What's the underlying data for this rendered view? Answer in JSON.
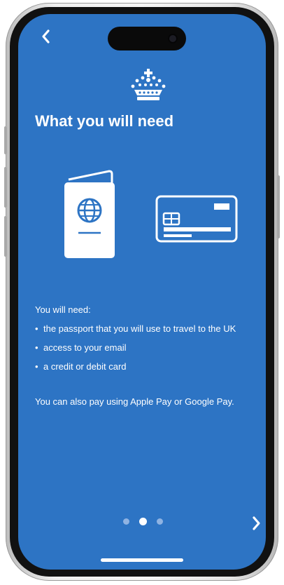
{
  "screen": {
    "title": "What you will need",
    "intro": "You will need:",
    "items": [
      "the passport that you will use to travel to the UK",
      "access to your email",
      "a credit or debit card"
    ],
    "extra": "You can also pay using Apple Pay or Google Pay."
  },
  "navigation": {
    "back_icon": "chevron-left-icon",
    "next_icon": "chevron-right-icon",
    "page_indicator": {
      "pages": 3,
      "current": 2
    }
  },
  "icons": {
    "logo": "crown-icon",
    "passport": "passport-icon",
    "card": "credit-card-icon"
  },
  "colors": {
    "background": "#2d74c4",
    "text": "#ffffff",
    "dot_inactive": "#8fb3e2"
  }
}
